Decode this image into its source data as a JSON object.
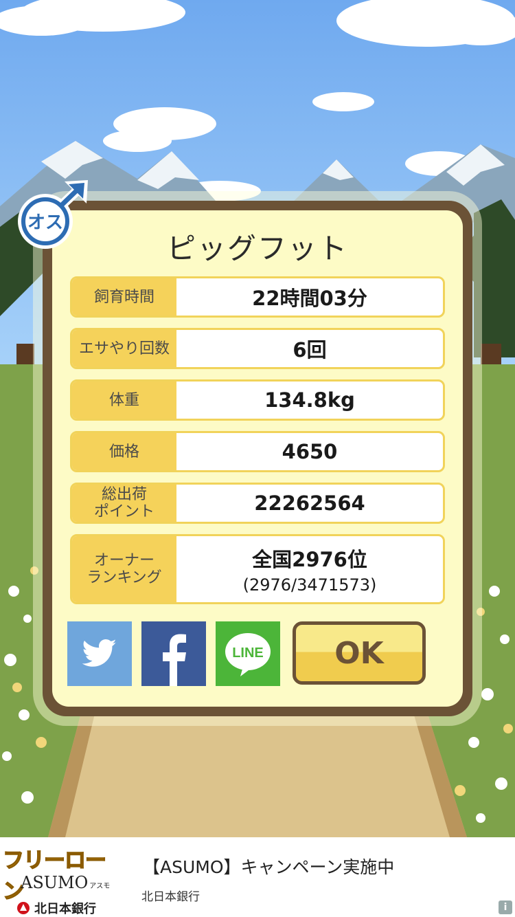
{
  "pet": {
    "name": "ピッグフット",
    "gender_badge_label": "オス"
  },
  "stats": [
    {
      "label": "飼育時間",
      "value": "22時間03分"
    },
    {
      "label": "エサやり回数",
      "value": "6回"
    },
    {
      "label": "体重",
      "value": "134.8kg"
    },
    {
      "label": "価格",
      "value": "4650"
    },
    {
      "label": "総出荷\nポイント",
      "value": "22262564"
    },
    {
      "label": "オーナー\nランキング",
      "value": "全国2976位",
      "sub": "(2976/3471573)"
    }
  ],
  "share": {
    "twitter_icon": "twitter-bird-icon",
    "facebook_icon": "facebook-f-icon",
    "line_icon": "line-icon",
    "line_text": "LINE"
  },
  "ok_label": "OK",
  "ad": {
    "logo_text": "フリーローン",
    "brand": "ASUMO",
    "brand_kana": "アスモ",
    "bank_name": "北日本銀行",
    "title": "【ASUMO】キャンペーン実施中",
    "subtitle": "北日本銀行",
    "info_label": "i"
  },
  "colors": {
    "frame": "#6b5236",
    "panel": "#fdfbc6",
    "label_bg": "#f5d25a",
    "twitter": "#6fa6dc",
    "facebook": "#3c5a99",
    "line": "#4cb539"
  }
}
